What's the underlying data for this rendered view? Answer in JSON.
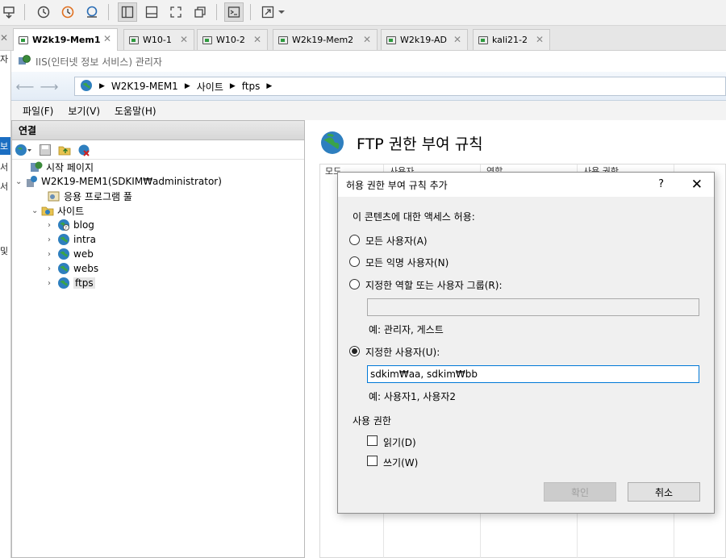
{
  "vm": {
    "tabs": [
      {
        "label": "W2k19-Mem1",
        "active": true
      },
      {
        "label": "W10-1"
      },
      {
        "label": "W10-2"
      },
      {
        "label": "W2k19-Mem2"
      },
      {
        "label": "W2k19-AD"
      },
      {
        "label": "kali21-2"
      }
    ],
    "tab_close": "✕"
  },
  "iis": {
    "title": "IIS(인터넷 정보 서비스) 관리자",
    "breadcrumb": [
      "W2K19-MEM1",
      "사이트",
      "ftps"
    ],
    "menu": [
      "파일(F)",
      "보기(V)",
      "도움말(H)"
    ]
  },
  "left_strip": [
    "보",
    "서",
    "서",
    "및"
  ],
  "connections": {
    "header": "연결",
    "tree": [
      {
        "label": "시작 페이지"
      },
      {
        "label": "W2K19-MEM1(SDKIM₩administrator)"
      },
      {
        "label": "응용 프로그램 풀"
      },
      {
        "label": "사이트"
      },
      {
        "label": "blog"
      },
      {
        "label": "intra"
      },
      {
        "label": "web"
      },
      {
        "label": "webs"
      },
      {
        "label": "ftps",
        "selected": true
      }
    ]
  },
  "content": {
    "title": "FTP 권한 부여 규칙",
    "columns": [
      "모드",
      "사용자",
      "역할",
      "사용 권한"
    ]
  },
  "dialog": {
    "title": "허용 권한 부여 규칙 추가",
    "help": "?",
    "close": "✕",
    "access_label": "이 콘텐츠에 대한 액세스 허용:",
    "option_all_users": "모든 사용자(A)",
    "option_anonymous": "모든 익명 사용자(N)",
    "option_roles": "지정한 역할 또는 사용자 그룹(R):",
    "roles_value": "",
    "roles_example": "예: 관리자, 게스트",
    "option_users": "지정한 사용자(U):",
    "selected_option": "users",
    "users_value": "sdkim₩aa, sdkim₩bb",
    "users_example": "예: 사용자1, 사용자2",
    "permissions_label": "사용 권한",
    "perm_read": "읽기(D)",
    "perm_write": "쓰기(W)",
    "read_checked": false,
    "write_checked": false,
    "ok": "확인",
    "cancel": "취소"
  },
  "colors": {
    "accent": "#0078d7",
    "globe": "#2e7fbf"
  }
}
